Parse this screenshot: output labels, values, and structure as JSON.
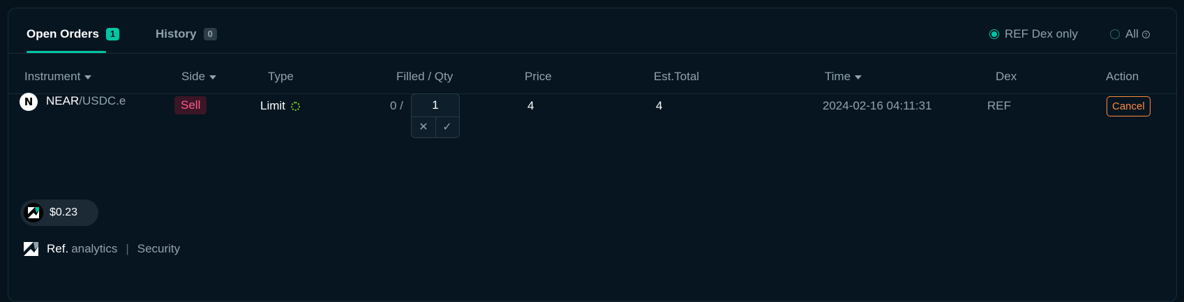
{
  "tabs": {
    "open_orders": {
      "label": "Open Orders",
      "count": "1"
    },
    "history": {
      "label": "History",
      "count": "0"
    }
  },
  "filters": {
    "ref_dex_only": "REF Dex only",
    "all": "All",
    "selected": "ref_dex_only"
  },
  "columns": {
    "instrument": "Instrument",
    "side": "Side",
    "type": "Type",
    "filled_qty": "Filled / Qty",
    "price": "Price",
    "est_total": "Est.Total",
    "time": "Time",
    "dex": "Dex",
    "action": "Action"
  },
  "orders": [
    {
      "base": "NEAR",
      "quote": "/USDC.e",
      "side": "Sell",
      "type": "Limit",
      "filled": "0 /",
      "qty": "1",
      "price": "4",
      "est_total": "4",
      "time": "2024-02-16 04:11:31",
      "dex": "REF",
      "action": "Cancel"
    }
  ],
  "ref_price": "$0.23",
  "footer": {
    "brand": "Ref.",
    "brand_sub": "analytics",
    "separator": "|",
    "security": "Security"
  },
  "colors": {
    "accent": "#00c6a2",
    "sell": "#ff5b8d",
    "cancel": "#ff8a3c",
    "background": "#06131d"
  },
  "icons": {
    "near": "near-logo-icon",
    "ref": "ref-logo-icon",
    "help": "help-circle-icon",
    "confirm": "check-icon",
    "cancel_edit": "close-icon",
    "pending": "spinner-icon"
  }
}
